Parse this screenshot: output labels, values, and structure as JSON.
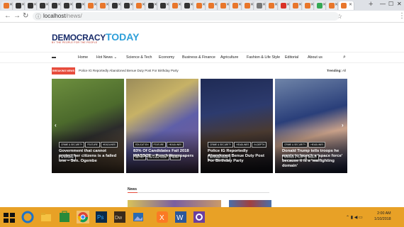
{
  "browser": {
    "url_host": "localhost",
    "url_path": "/news/",
    "new_tab": "+",
    "window_min": "—",
    "window_max": "☐",
    "window_close": "✕"
  },
  "site": {
    "logo_main": "DEMOCRACY",
    "logo_today": "TODAY",
    "logo_tagline": "BY THE PEOPLE FOR THE PEOPLE",
    "nav": [
      "Home",
      "Hot News",
      "Science & Tech",
      "Economy",
      "Business & Finance",
      "Agriculture",
      "Fashion & Life Style",
      "Editorial",
      "About us"
    ],
    "breaking_label": "BREAKING NEWS",
    "breaking_text": "Police IG Reportedly Abandoned Benue Duty Post For Birthday Party",
    "trending_label": "Trending:",
    "trending_value": "All",
    "section_title": "News"
  },
  "cards": [
    {
      "tags": [
        "CRIME & SECURITY",
        "FEATURE",
        "HEADLINES",
        "INTERVIEW"
      ],
      "title": "Government that cannot protect her citizens is a failed one – Sen. Ogembe"
    },
    {
      "tags": [
        "EDUCATION",
        "FEATURE",
        "HEADLINES",
        "METRO",
        "NATIONAL ISSUE",
        "NEWS"
      ],
      "title": "83% Of Candidates Fail 2018 WASSCE – Punch Newspapers"
    },
    {
      "tags": [
        "CRIME & SECURITY",
        "HEADLINES",
        "IN-DEPTH",
        "NATIONAL ISSUE"
      ],
      "title": "Police IG Reportedly Abandoned Benue Duty Post For Birthday Party"
    },
    {
      "tags": [
        "CRIME & SECURITY",
        "HEADLINES",
        "SCIENCE & TECH",
        "WORLD"
      ],
      "title": "Donald Trump tells troops he wants to launch a 'space force' because it is a 'warfighting domain'"
    }
  ],
  "taskbar": {
    "time": "2:00 AM",
    "date": "1/10/2018"
  },
  "colors": {
    "taskbar": "#e8a126",
    "breaking": "#e74c3c",
    "logo_blue": "#1a2d6b",
    "logo_light": "#2d9fd9"
  }
}
